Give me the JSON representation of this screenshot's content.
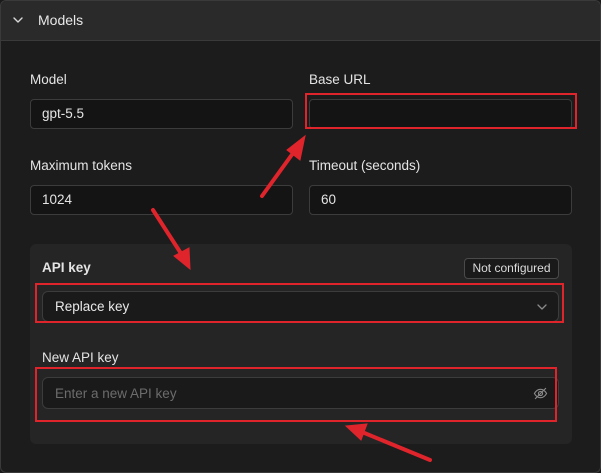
{
  "section": {
    "title": "Models",
    "toggle_icon": "chevron-down-icon"
  },
  "model": {
    "label": "Model",
    "value": "gpt-5.5"
  },
  "base_url": {
    "label": "Base URL",
    "value": ""
  },
  "max_tokens": {
    "label": "Maximum tokens",
    "value": "1024"
  },
  "timeout": {
    "label": "Timeout (seconds)",
    "value": "60"
  },
  "api_key": {
    "label": "API key",
    "status_badge": "Not configured",
    "select_value": "Replace key",
    "dropdown_icon": "chevron-down-icon"
  },
  "new_api_key": {
    "label": "New API key",
    "value": "",
    "placeholder": "Enter a new API key",
    "visibility_icon": "eye-off-icon"
  },
  "colors": {
    "highlight": "#e0242c",
    "background": "#1c1c1c",
    "panel": "#252525"
  }
}
